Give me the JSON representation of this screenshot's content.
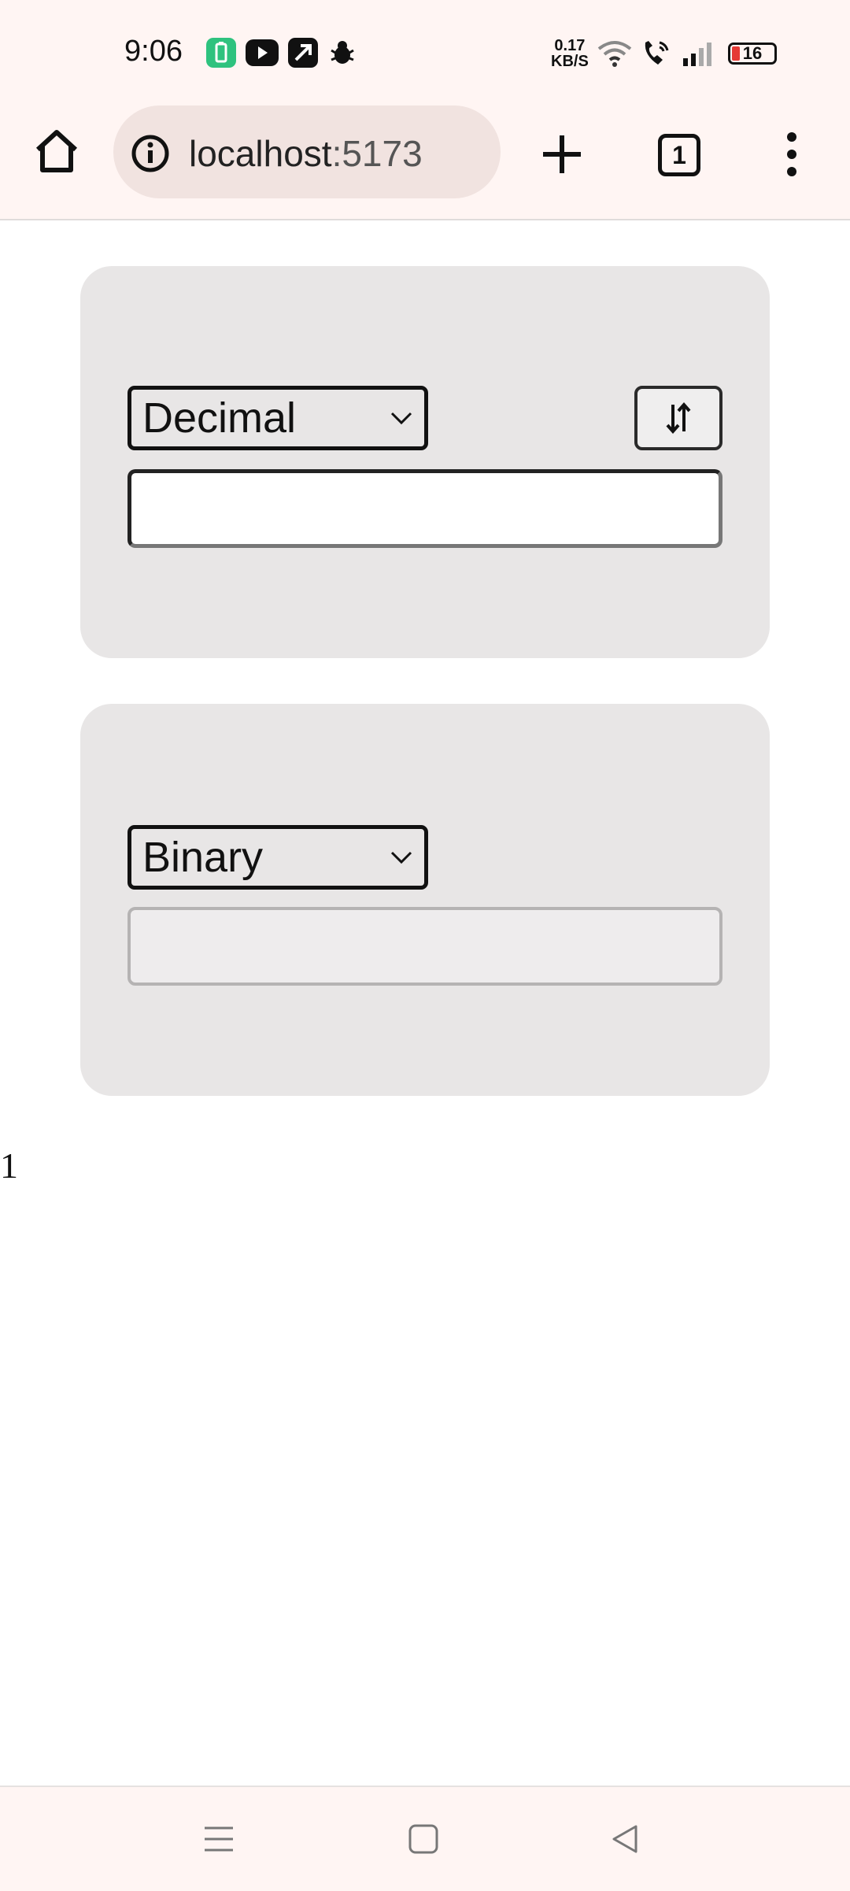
{
  "status_bar": {
    "time": "9:06",
    "net_speed_value": "0.17",
    "net_speed_unit": "KB/S",
    "battery_level": "16",
    "icons": [
      "battery-saver-app-icon",
      "youtube-icon",
      "app-icon",
      "bug-icon",
      "wifi-icon",
      "call-icon",
      "signal-icon",
      "battery-icon"
    ]
  },
  "browser": {
    "url_host": "localhost",
    "url_port": ":5173",
    "tab_count": "1",
    "icons": [
      "home-icon",
      "info-icon",
      "plus-icon",
      "tabs-icon",
      "more-vert-icon"
    ]
  },
  "converter": {
    "from_select": {
      "selected": "Decimal"
    },
    "input": {
      "value": "",
      "placeholder": ""
    },
    "swap_icon": "swap-vertical-icon",
    "to_select": {
      "selected": "Binary"
    },
    "output": {
      "value": ""
    }
  },
  "stray_text": "1",
  "nav_bar": {
    "icons": [
      "menu-icon",
      "home-square-icon",
      "back-triangle-icon"
    ]
  },
  "colors": {
    "card_background": "#e8e6e6",
    "chrome_background": "#fff5f3",
    "urlbar_background": "#f1e3e0"
  }
}
